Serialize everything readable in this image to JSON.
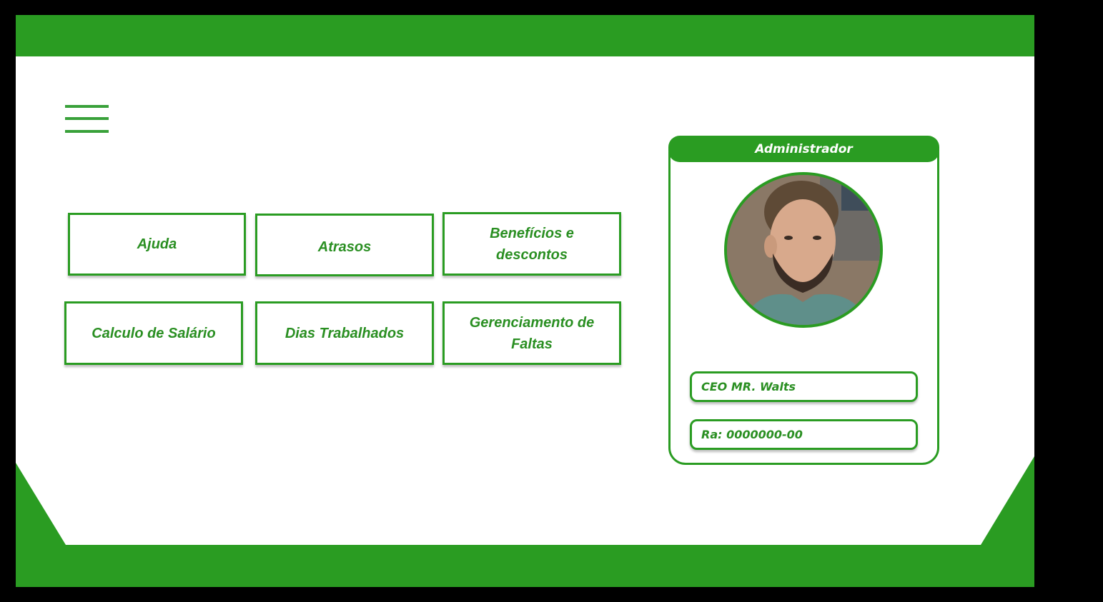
{
  "colors": {
    "brand": "#2a9c22",
    "text_green": "#2a8f22",
    "background": "#ffffff",
    "outer": "#000000"
  },
  "icons": {
    "menu": "hamburger-menu-icon",
    "avatar": "profile-photo"
  },
  "tiles": [
    {
      "label": "Ajuda"
    },
    {
      "label": "Atrasos"
    },
    {
      "label_line1": "Benefícios e",
      "label_line2": "descontos"
    },
    {
      "label": "Calculo de Salário"
    },
    {
      "label": "Dias Trabalhados"
    },
    {
      "label_line1": "Gerenciamento de",
      "label_line2": "Faltas"
    }
  ],
  "profile": {
    "role": "Administrador",
    "name": "CEO MR. Walts",
    "ra": "Ra: 0000000-00"
  }
}
